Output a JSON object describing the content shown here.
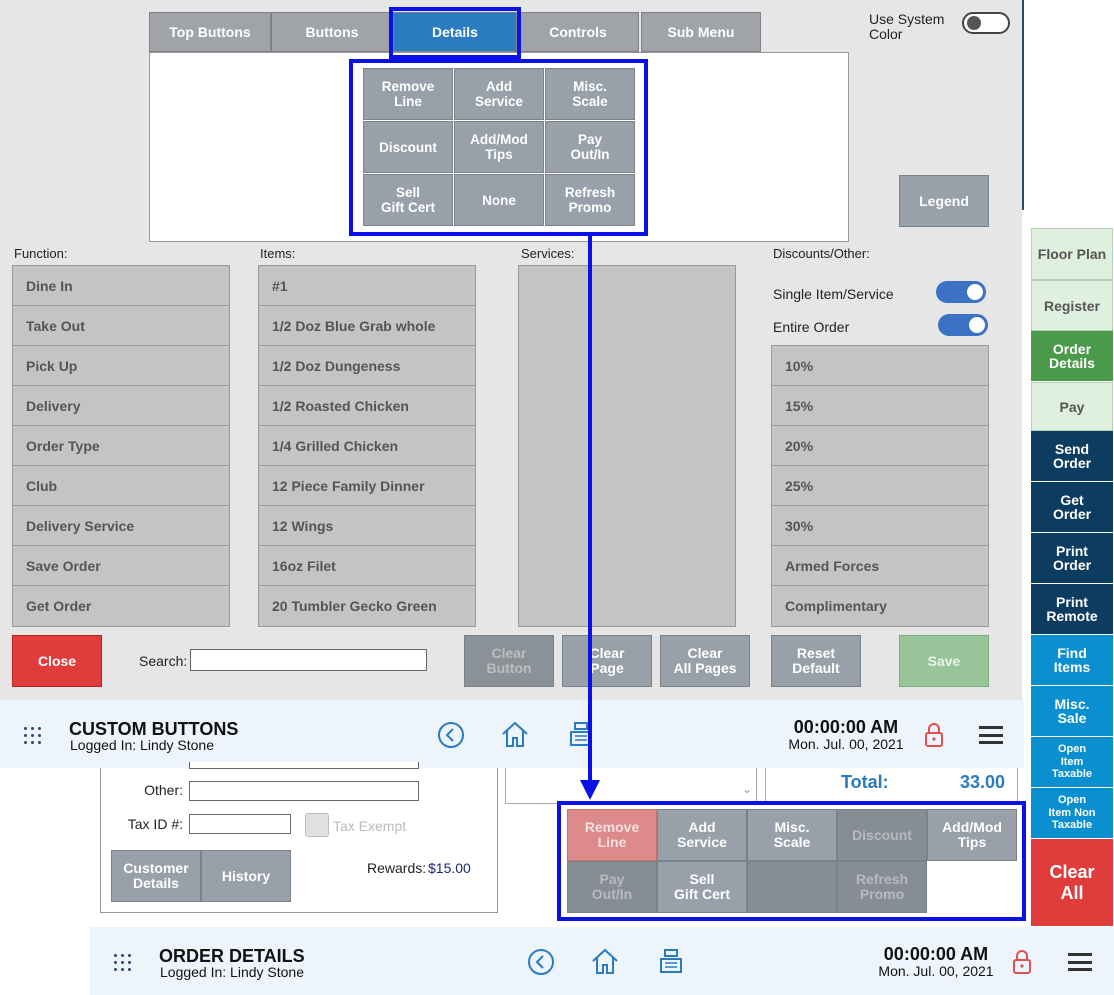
{
  "editor": {
    "tabs": [
      "Top Buttons",
      "Buttons",
      "Details",
      "Controls",
      "Sub Menu"
    ],
    "active_tab": "Details",
    "preview_buttons": [
      "Remove\nLine",
      "Add\nService",
      "Misc.\nScale",
      "Discount",
      "Add/Mod\nTips",
      "Pay\nOut/In",
      "Sell\nGift Cert",
      "None",
      "Refresh\nPromo"
    ],
    "use_system_color_label": "Use System Color",
    "legend_label": "Legend",
    "function_label": "Function:",
    "items_label": "Items:",
    "services_label": "Services:",
    "discounts_label": "Discounts/Other:",
    "function_items": [
      "Dine In",
      "Take Out",
      "Pick Up",
      "Delivery",
      "Order Type",
      "Club",
      "Delivery Service",
      "Save Order",
      "Get Order"
    ],
    "items": [
      "#1",
      "1/2 Doz Blue Grab whole",
      "1/2 Doz Dungeness",
      "1/2 Roasted Chicken",
      "1/4 Grilled Chicken",
      "12 Piece Family Dinner",
      "12 Wings",
      "16oz Filet",
      "20 Tumbler Gecko Green"
    ],
    "single_item_label": "Single Item/Service",
    "entire_order_label": "Entire Order",
    "discount_items": [
      "10%",
      "15%",
      "20%",
      "25%",
      "30%",
      "Armed Forces",
      "Complimentary"
    ],
    "close_label": "Close",
    "search_label": "Search:",
    "search_value": "",
    "clear_button_label": "Clear\nButton",
    "clear_page_label": "Clear\nPage",
    "clear_all_pages_label": "Clear\nAll Pages",
    "reset_default_label": "Reset\nDefault",
    "save_label": "Save"
  },
  "custom_bar": {
    "title": "CUSTOM BUTTONS",
    "logged_in": "Logged In:  Lindy Stone",
    "time": "00:00:00 AM",
    "date": "Mon. Jul. 00, 2021"
  },
  "order_panel": {
    "other_label": "Other:",
    "tax_id_label": "Tax ID #:",
    "tax_exempt_label": "Tax Exempt",
    "customer_details_label": "Customer\nDetails",
    "history_label": "History",
    "rewards_label": "Rewards:",
    "rewards_value": "$15.00",
    "total_label": "Total:",
    "total_value": "33.00"
  },
  "detail_buttons": [
    {
      "label": "Remove\nLine",
      "style": "red"
    },
    {
      "label": "Add\nService",
      "style": "gray"
    },
    {
      "label": "Misc.\nScale",
      "style": "gray"
    },
    {
      "label": "Discount",
      "style": "dark"
    },
    {
      "label": "Add/Mod\nTips",
      "style": "gray"
    },
    {
      "label": "Pay\nOut/In",
      "style": "dark"
    },
    {
      "label": "Sell\nGift Cert",
      "style": "gray"
    },
    {
      "label": "",
      "style": "dark"
    },
    {
      "label": "Refresh\nPromo",
      "style": "dark"
    }
  ],
  "side_menu": [
    {
      "label": "Floor Plan",
      "style": "light"
    },
    {
      "label": "Register",
      "style": "light"
    },
    {
      "label": "Order\nDetails",
      "style": "green"
    },
    {
      "label": "Pay",
      "style": "light"
    },
    {
      "label": "Send\nOrder",
      "style": "navy"
    },
    {
      "label": "Get\nOrder",
      "style": "navy"
    },
    {
      "label": "Print\nOrder",
      "style": "navy"
    },
    {
      "label": "Print\nRemote",
      "style": "navy"
    },
    {
      "label": "Find\nItems",
      "style": "cyan"
    },
    {
      "label": "Misc.\nSale",
      "style": "cyan"
    },
    {
      "label": "Open\nItem\nTaxable",
      "style": "cyan-small"
    },
    {
      "label": "Open\nItem Non\nTaxable",
      "style": "cyan-small"
    },
    {
      "label": "Clear\nAll",
      "style": "red"
    }
  ],
  "order_bar": {
    "title": "ORDER DETAILS",
    "logged_in": "Logged In:  Lindy Stone",
    "time": "00:00:00 AM",
    "date": "Mon. Jul. 00, 2021"
  },
  "colors": {
    "accent_blue": "#2a7bbf",
    "highlight": "#0a10e8",
    "close_red": "#e03c3c",
    "save_green": "#98c49a",
    "navy": "#0d3c61",
    "cyan": "#0a8fd0",
    "order_green": "#4a9a4a"
  }
}
